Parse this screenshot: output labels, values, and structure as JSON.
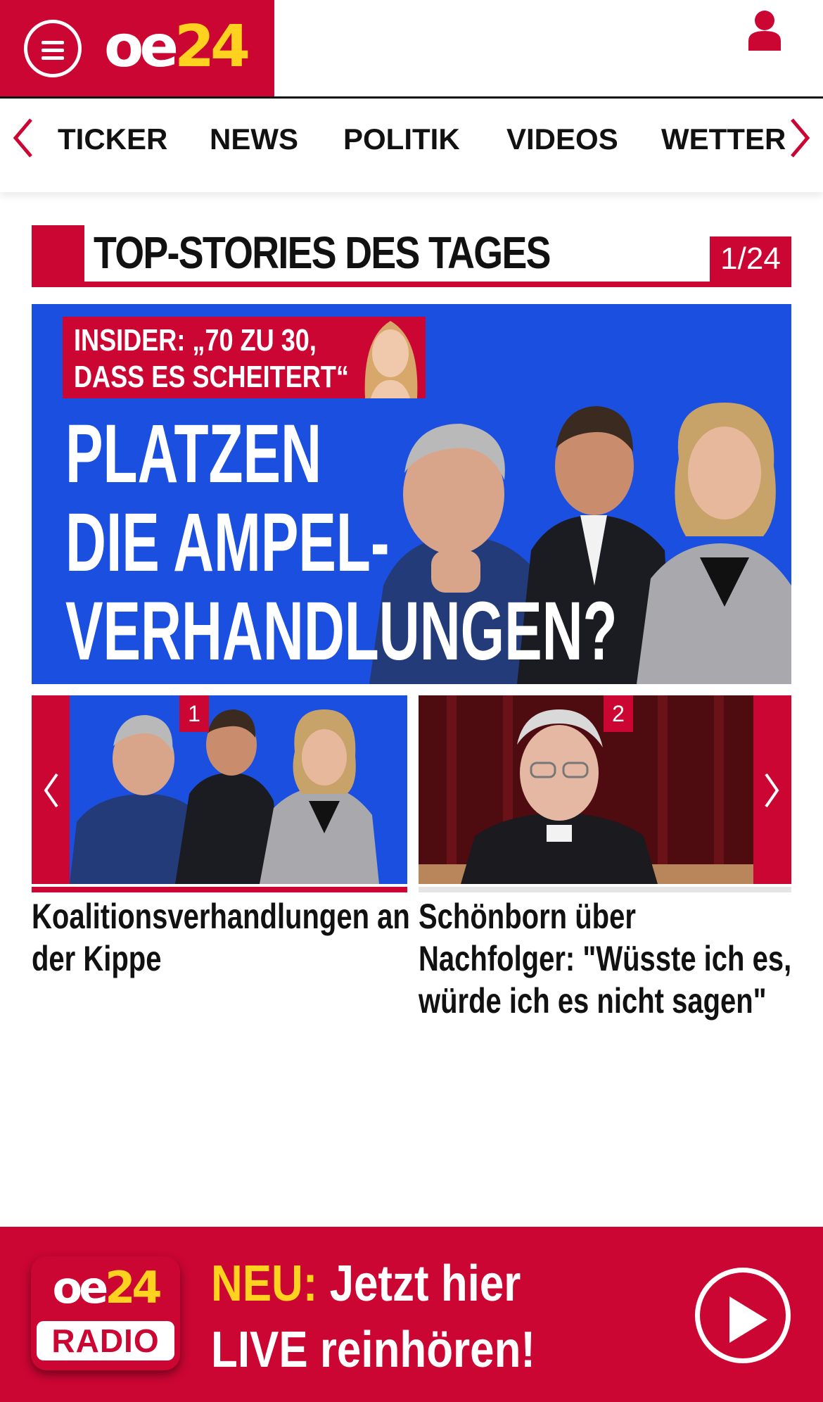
{
  "header": {
    "logo_oe": "oe",
    "logo_num": "24",
    "menu_icon": "hamburger-icon",
    "user_icon": "user-icon"
  },
  "nav": {
    "items": [
      {
        "label": "TICKER"
      },
      {
        "label": "NEWS"
      },
      {
        "label": "POLITIK"
      },
      {
        "label": "VIDEOS"
      },
      {
        "label": "WETTER"
      }
    ],
    "prev_icon": "chevron-left-icon",
    "next_icon": "chevron-right-icon"
  },
  "section": {
    "title": "TOP-STORIES DES TAGES",
    "counter": "1/24"
  },
  "hero": {
    "kicker_line1": "INSIDER: „70 ZU 30,",
    "kicker_line2": "DASS ES SCHEITERT“",
    "headline_line1": "PLATZEN",
    "headline_line2": "DIE AMPEL-",
    "headline_line3": "VERHANDLUNGEN?"
  },
  "carousel": {
    "cards": [
      {
        "number": "1",
        "title_line1": "Koalitionsverhandlungen an",
        "title_line2": "der Kippe",
        "title_line3": ""
      },
      {
        "number": "2",
        "title_line1": "Schönborn über",
        "title_line2": "Nachfolger: \"Wüsste ich es,",
        "title_line3": "würde ich es nicht sagen\""
      }
    ]
  },
  "radio": {
    "logo_oe": "oe",
    "logo_num": "24",
    "label": "RADIO",
    "neu": "NEU:",
    "line1_rest": " Jetzt hier",
    "line2": "LIVE reinhören!"
  },
  "colors": {
    "brand_red": "#cc0633",
    "brand_yellow": "#ffd21f",
    "hero_blue": "#1a4fe0"
  }
}
